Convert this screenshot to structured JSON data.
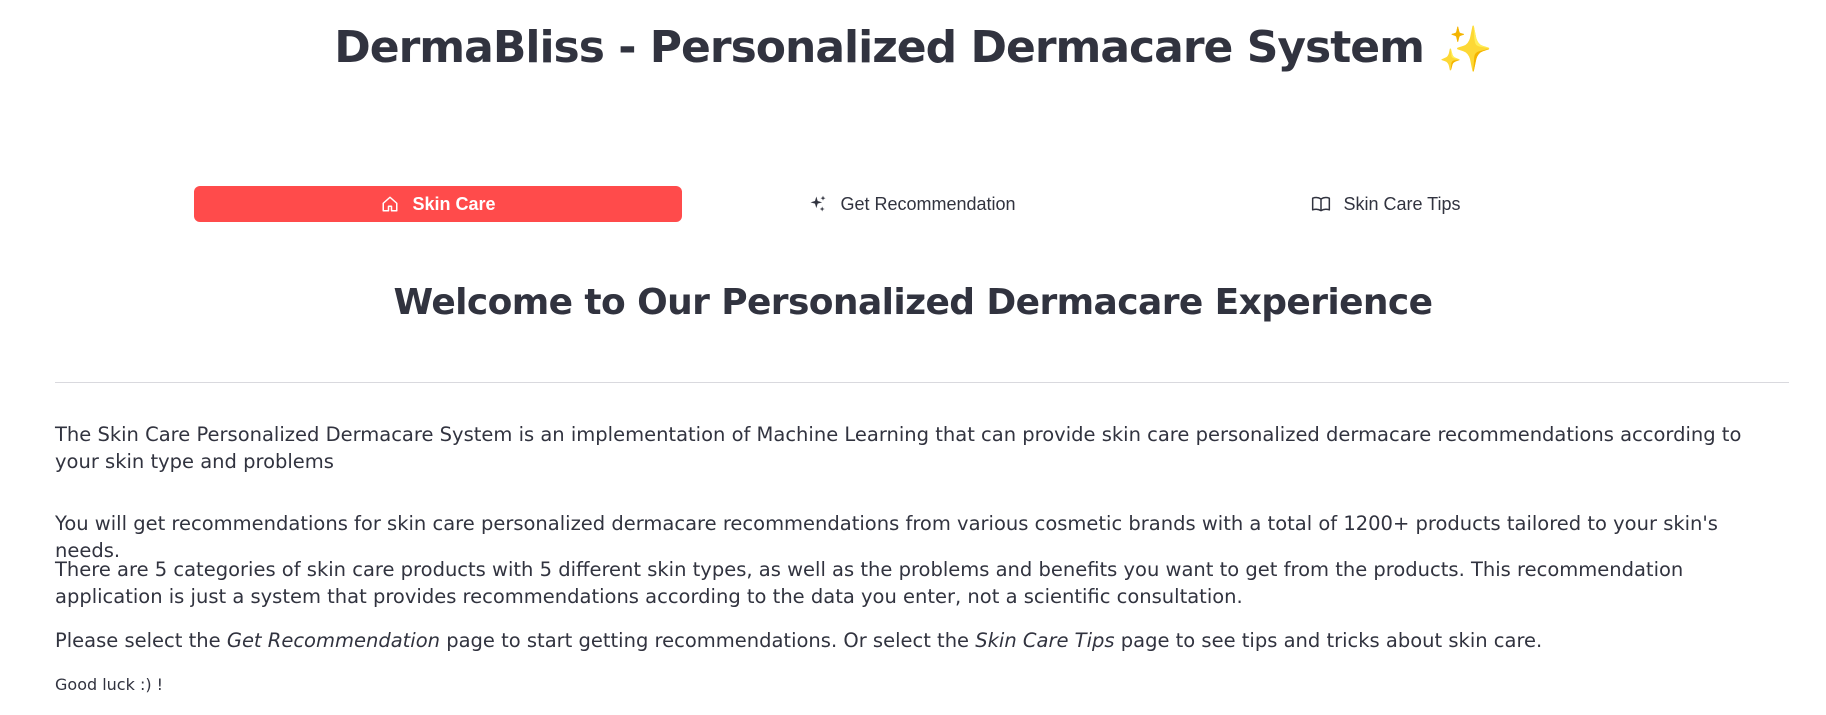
{
  "header": {
    "title": "DermaBliss - Personalized Dermacare System",
    "title_icon": "sparkles-icon"
  },
  "nav": {
    "tabs": [
      {
        "label": "Skin Care",
        "icon": "home-icon",
        "active": true
      },
      {
        "label": "Get Recommendation",
        "icon": "sparkles-icon",
        "active": false
      },
      {
        "label": "Skin Care Tips",
        "icon": "book-icon",
        "active": false
      }
    ],
    "active_color": "#ff4b4b"
  },
  "main": {
    "heading": "Welcome to Our Personalized Dermacare Experience",
    "paragraph1": "The Skin Care Personalized Dermacare System is an implementation of Machine Learning that can provide skin care personalized dermacare recommendations according to your skin type and problems",
    "paragraph2": "You will get recommendations for skin care personalized dermacare recommendations from various cosmetic brands with a total of 1200+ products tailored to your skin's needs.",
    "paragraph3": "There are 5 categories of skin care products with 5 different skin types, as well as the problems and benefits you want to get from the products. This recommendation application is just a system that provides recommendations according to the data you enter, not a scientific consultation.",
    "paragraph4_part1": "Please select the ",
    "paragraph4_link1": "Get Recommendation",
    "paragraph4_part2": " page to start getting recommendations. Or select the ",
    "paragraph4_link2": "Skin Care Tips",
    "paragraph4_part3": " page to see tips and tricks about skin care.",
    "closing": "Good luck :) !"
  }
}
